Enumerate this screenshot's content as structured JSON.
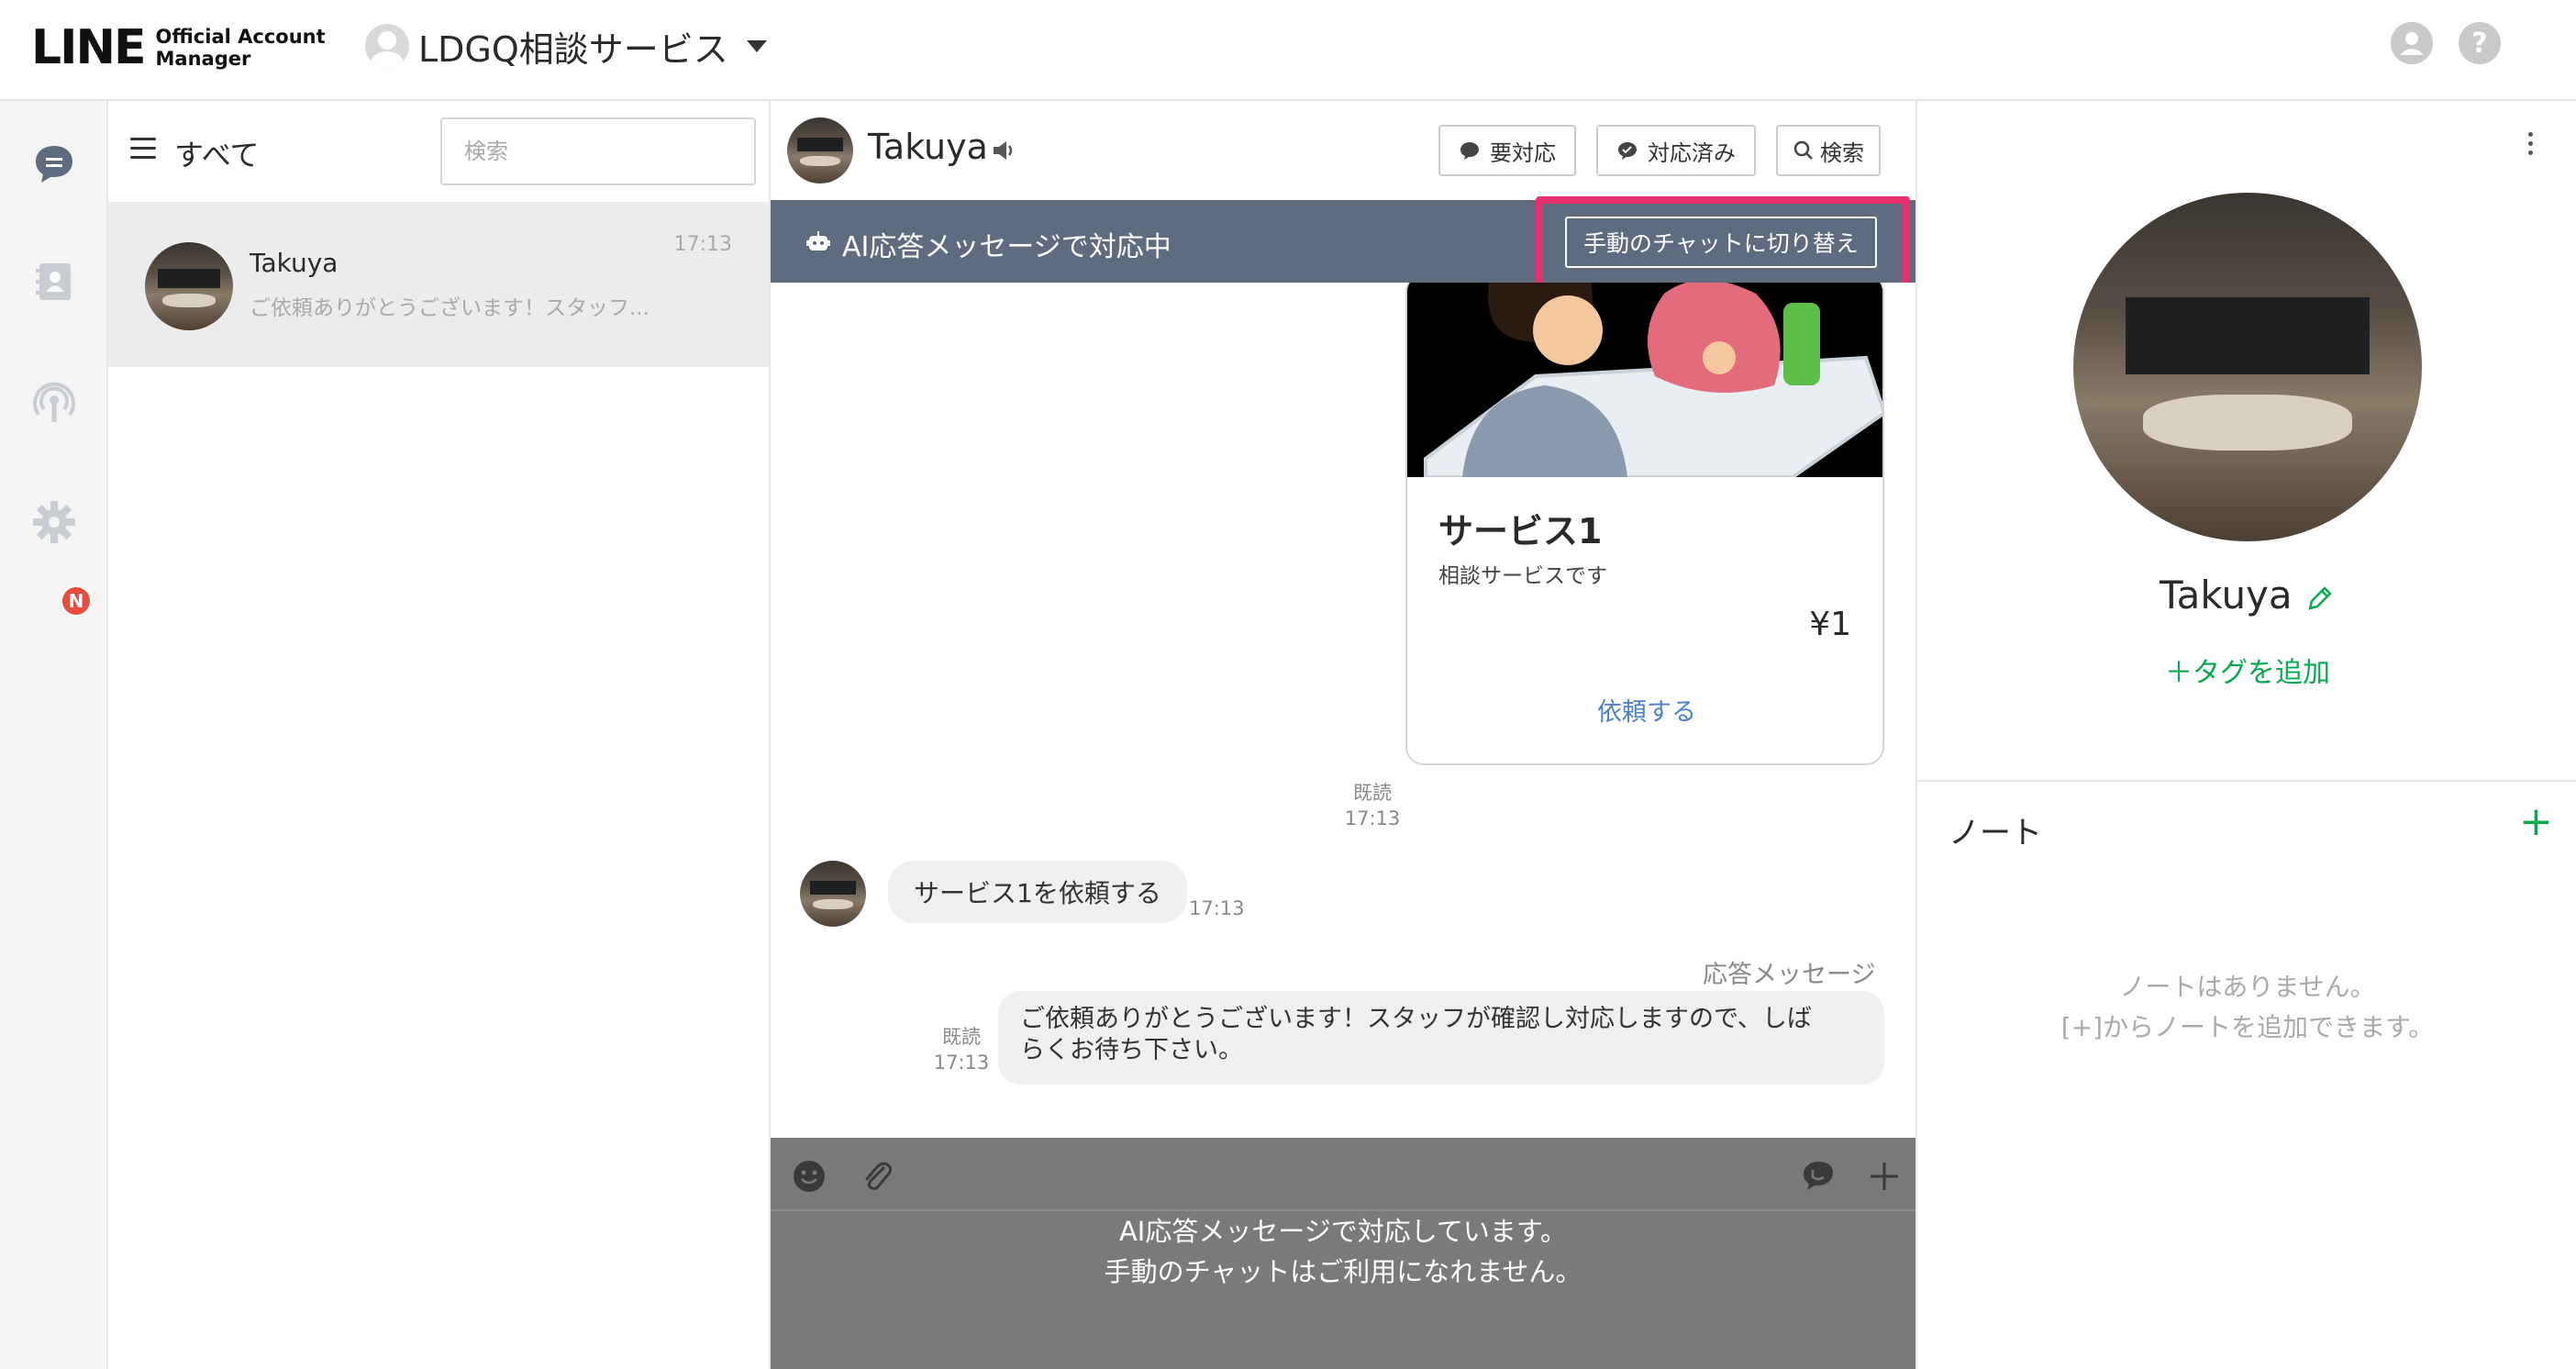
{
  "header": {
    "logo_main": "LINE",
    "logo_sub_line1": "Official Account",
    "logo_sub_line2": "Manager",
    "account_name": "LDGQ相談サービス"
  },
  "rail": {
    "badge": "N"
  },
  "chat_list": {
    "filter_label": "すべて",
    "search_placeholder": "検索",
    "items": [
      {
        "name": "Takuya",
        "preview": "ご依頼ありがとうございます！スタッフ...",
        "time": "17:13"
      }
    ]
  },
  "conversation": {
    "contact_name": "Takuya",
    "buttons": {
      "needs_action": "要対応",
      "done": "対応済み",
      "search": "検索"
    },
    "ai_bar": {
      "text": "AI応答メッセージで対応中",
      "switch_button": "手動のチャットに切り替え"
    },
    "card": {
      "title": "サービス1",
      "description": "相談サービスです",
      "price": "¥1",
      "action": "依頼する"
    },
    "card_read": {
      "label": "既読",
      "time": "17:13"
    },
    "user_message": {
      "text": "サービス1を依頼する",
      "time": "17:13"
    },
    "response_label": "応答メッセージ",
    "bot_message": {
      "line1": "ご依頼ありがとうございます！スタッフが確認し対応しますので、しば",
      "line2": "らくお待ち下さい。",
      "read": "既読",
      "time": "17:13"
    },
    "composer": {
      "line1": "AI応答メッセージで対応しています。",
      "line2": "手動のチャットはご利用になれません。"
    }
  },
  "profile": {
    "name": "Takuya",
    "add_tag": "＋タグを追加",
    "note_title": "ノート",
    "note_add": "+",
    "note_empty_line1": "ノートはありません。",
    "note_empty_line2": "[+]からノートを追加できます。"
  },
  "colors": {
    "line_green": "#06a94d",
    "ai_bar": "#5f6b7e",
    "highlight": "#e8306e",
    "badge_red": "#e74c3c",
    "composer_disabled": "#7a7a7a"
  }
}
